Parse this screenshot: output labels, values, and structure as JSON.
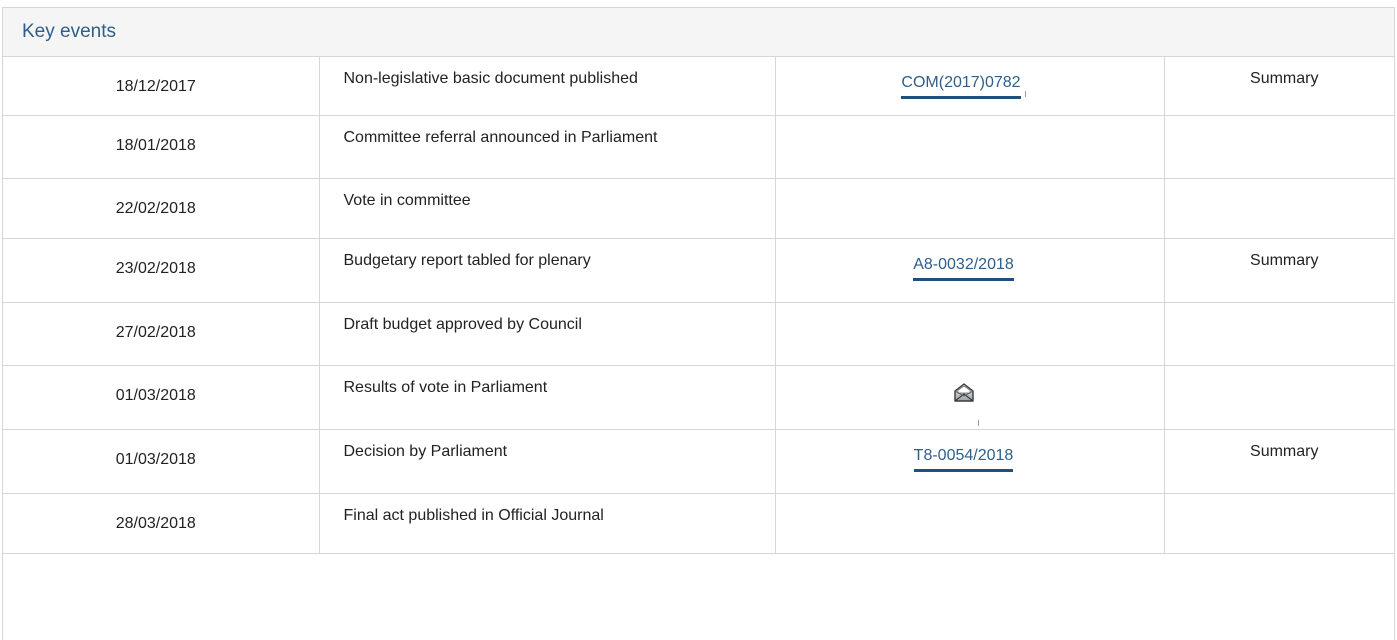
{
  "panel": {
    "title": "Key events"
  },
  "events": [
    {
      "date": "18/12/2017",
      "event": "Non-legislative basic document published",
      "reference": "COM(2017)0782",
      "summary": "Summary"
    },
    {
      "date": "18/01/2018",
      "event": "Committee referral announced in Parliament",
      "reference": "",
      "summary": ""
    },
    {
      "date": "22/02/2018",
      "event": "Vote in committee",
      "reference": "",
      "summary": ""
    },
    {
      "date": "23/02/2018",
      "event": "Budgetary report tabled for plenary",
      "reference": "A8-0032/2018",
      "summary": "Summary"
    },
    {
      "date": "27/02/2018",
      "event": "Draft budget approved by Council",
      "reference": "",
      "summary": ""
    },
    {
      "date": "01/03/2018",
      "event": "Results of vote in Parliament",
      "reference_icon": "envelope-icon",
      "summary": ""
    },
    {
      "date": "01/03/2018",
      "event": "Decision by Parliament",
      "reference": "T8-0054/2018",
      "summary": "Summary"
    },
    {
      "date": "28/03/2018",
      "event": "Final act published in Official Journal",
      "reference": "",
      "summary": ""
    }
  ],
  "colors": {
    "link": "#2e5f8a",
    "link_underline": "#1f4f7c",
    "header_bg": "#f5f5f5",
    "border": "#d6d6d6"
  }
}
